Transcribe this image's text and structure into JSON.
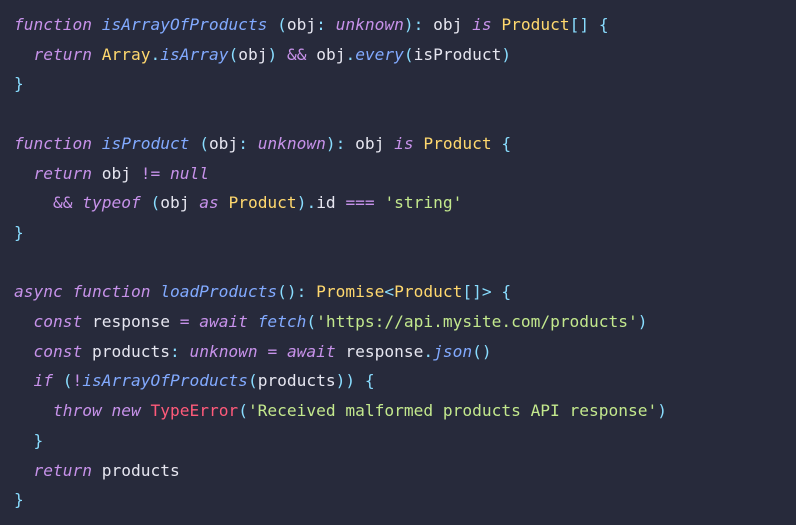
{
  "code": {
    "lines": [
      {
        "spans": [
          {
            "c": "kw",
            "t": "function"
          },
          {
            "c": "id",
            "t": " "
          },
          {
            "c": "fn",
            "t": "isArrayOfProducts"
          },
          {
            "c": "id",
            "t": " "
          },
          {
            "c": "punc",
            "t": "("
          },
          {
            "c": "id",
            "t": "obj"
          },
          {
            "c": "punc",
            "t": ":"
          },
          {
            "c": "id",
            "t": " "
          },
          {
            "c": "type",
            "t": "unknown"
          },
          {
            "c": "punc",
            "t": ")"
          },
          {
            "c": "punc",
            "t": ":"
          },
          {
            "c": "id",
            "t": " obj "
          },
          {
            "c": "kw",
            "t": "is"
          },
          {
            "c": "id",
            "t": " "
          },
          {
            "c": "cls",
            "t": "Product"
          },
          {
            "c": "punc",
            "t": "[]"
          },
          {
            "c": "id",
            "t": " "
          },
          {
            "c": "punc",
            "t": "{"
          }
        ]
      },
      {
        "spans": [
          {
            "c": "id",
            "t": "  "
          },
          {
            "c": "kw",
            "t": "return"
          },
          {
            "c": "id",
            "t": " "
          },
          {
            "c": "cls",
            "t": "Array"
          },
          {
            "c": "punc",
            "t": "."
          },
          {
            "c": "fn",
            "t": "isArray"
          },
          {
            "c": "punc",
            "t": "("
          },
          {
            "c": "id",
            "t": "obj"
          },
          {
            "c": "punc",
            "t": ")"
          },
          {
            "c": "id",
            "t": " "
          },
          {
            "c": "op",
            "t": "&&"
          },
          {
            "c": "id",
            "t": " obj"
          },
          {
            "c": "punc",
            "t": "."
          },
          {
            "c": "fn",
            "t": "every"
          },
          {
            "c": "punc",
            "t": "("
          },
          {
            "c": "id",
            "t": "isProduct"
          },
          {
            "c": "punc",
            "t": ")"
          }
        ]
      },
      {
        "spans": [
          {
            "c": "punc",
            "t": "}"
          }
        ]
      },
      {
        "spans": [
          {
            "c": "id",
            "t": " "
          }
        ]
      },
      {
        "spans": [
          {
            "c": "kw",
            "t": "function"
          },
          {
            "c": "id",
            "t": " "
          },
          {
            "c": "fn",
            "t": "isProduct"
          },
          {
            "c": "id",
            "t": " "
          },
          {
            "c": "punc",
            "t": "("
          },
          {
            "c": "id",
            "t": "obj"
          },
          {
            "c": "punc",
            "t": ":"
          },
          {
            "c": "id",
            "t": " "
          },
          {
            "c": "type",
            "t": "unknown"
          },
          {
            "c": "punc",
            "t": ")"
          },
          {
            "c": "punc",
            "t": ":"
          },
          {
            "c": "id",
            "t": " obj "
          },
          {
            "c": "kw",
            "t": "is"
          },
          {
            "c": "id",
            "t": " "
          },
          {
            "c": "cls",
            "t": "Product"
          },
          {
            "c": "id",
            "t": " "
          },
          {
            "c": "punc",
            "t": "{"
          }
        ]
      },
      {
        "spans": [
          {
            "c": "id",
            "t": "  "
          },
          {
            "c": "kw",
            "t": "return"
          },
          {
            "c": "id",
            "t": " obj "
          },
          {
            "c": "op",
            "t": "!="
          },
          {
            "c": "id",
            "t": " "
          },
          {
            "c": "type",
            "t": "null"
          }
        ]
      },
      {
        "spans": [
          {
            "c": "id",
            "t": "    "
          },
          {
            "c": "op",
            "t": "&&"
          },
          {
            "c": "id",
            "t": " "
          },
          {
            "c": "kw",
            "t": "typeof"
          },
          {
            "c": "id",
            "t": " "
          },
          {
            "c": "punc",
            "t": "("
          },
          {
            "c": "id",
            "t": "obj "
          },
          {
            "c": "kw",
            "t": "as"
          },
          {
            "c": "id",
            "t": " "
          },
          {
            "c": "cls",
            "t": "Product"
          },
          {
            "c": "punc",
            "t": ")"
          },
          {
            "c": "punc",
            "t": "."
          },
          {
            "c": "id",
            "t": "id "
          },
          {
            "c": "op",
            "t": "==="
          },
          {
            "c": "id",
            "t": " "
          },
          {
            "c": "str",
            "t": "'string'"
          }
        ]
      },
      {
        "spans": [
          {
            "c": "punc",
            "t": "}"
          }
        ]
      },
      {
        "spans": [
          {
            "c": "id",
            "t": " "
          }
        ]
      },
      {
        "spans": [
          {
            "c": "kw",
            "t": "async"
          },
          {
            "c": "id",
            "t": " "
          },
          {
            "c": "kw",
            "t": "function"
          },
          {
            "c": "id",
            "t": " "
          },
          {
            "c": "fn",
            "t": "loadProducts"
          },
          {
            "c": "punc",
            "t": "()"
          },
          {
            "c": "punc",
            "t": ":"
          },
          {
            "c": "id",
            "t": " "
          },
          {
            "c": "cls",
            "t": "Promise"
          },
          {
            "c": "punc",
            "t": "<"
          },
          {
            "c": "cls",
            "t": "Product"
          },
          {
            "c": "punc",
            "t": "[]>"
          },
          {
            "c": "id",
            "t": " "
          },
          {
            "c": "punc",
            "t": "{"
          }
        ]
      },
      {
        "spans": [
          {
            "c": "id",
            "t": "  "
          },
          {
            "c": "kw",
            "t": "const"
          },
          {
            "c": "id",
            "t": " response "
          },
          {
            "c": "op",
            "t": "="
          },
          {
            "c": "id",
            "t": " "
          },
          {
            "c": "kw",
            "t": "await"
          },
          {
            "c": "id",
            "t": " "
          },
          {
            "c": "fn",
            "t": "fetch"
          },
          {
            "c": "punc",
            "t": "("
          },
          {
            "c": "str",
            "t": "'https://api.mysite.com/products'"
          },
          {
            "c": "punc",
            "t": ")"
          }
        ]
      },
      {
        "spans": [
          {
            "c": "id",
            "t": "  "
          },
          {
            "c": "kw",
            "t": "const"
          },
          {
            "c": "id",
            "t": " products"
          },
          {
            "c": "punc",
            "t": ":"
          },
          {
            "c": "id",
            "t": " "
          },
          {
            "c": "type",
            "t": "unknown"
          },
          {
            "c": "id",
            "t": " "
          },
          {
            "c": "op",
            "t": "="
          },
          {
            "c": "id",
            "t": " "
          },
          {
            "c": "kw",
            "t": "await"
          },
          {
            "c": "id",
            "t": " response"
          },
          {
            "c": "punc",
            "t": "."
          },
          {
            "c": "fn",
            "t": "json"
          },
          {
            "c": "punc",
            "t": "()"
          }
        ]
      },
      {
        "spans": [
          {
            "c": "id",
            "t": "  "
          },
          {
            "c": "kw",
            "t": "if"
          },
          {
            "c": "id",
            "t": " "
          },
          {
            "c": "punc",
            "t": "("
          },
          {
            "c": "op",
            "t": "!"
          },
          {
            "c": "fn",
            "t": "isArrayOfProducts"
          },
          {
            "c": "punc",
            "t": "("
          },
          {
            "c": "id",
            "t": "products"
          },
          {
            "c": "punc",
            "t": "))"
          },
          {
            "c": "id",
            "t": " "
          },
          {
            "c": "punc",
            "t": "{"
          }
        ]
      },
      {
        "spans": [
          {
            "c": "id",
            "t": "    "
          },
          {
            "c": "kw",
            "t": "throw"
          },
          {
            "c": "id",
            "t": " "
          },
          {
            "c": "kw",
            "t": "new"
          },
          {
            "c": "id",
            "t": " "
          },
          {
            "c": "err",
            "t": "TypeError"
          },
          {
            "c": "punc",
            "t": "("
          },
          {
            "c": "str",
            "t": "'Received malformed products API response'"
          },
          {
            "c": "punc",
            "t": ")"
          }
        ]
      },
      {
        "spans": [
          {
            "c": "id",
            "t": "  "
          },
          {
            "c": "punc",
            "t": "}"
          }
        ]
      },
      {
        "spans": [
          {
            "c": "id",
            "t": "  "
          },
          {
            "c": "kw",
            "t": "return"
          },
          {
            "c": "id",
            "t": " products"
          }
        ]
      },
      {
        "spans": [
          {
            "c": "punc",
            "t": "}"
          }
        ]
      }
    ]
  }
}
